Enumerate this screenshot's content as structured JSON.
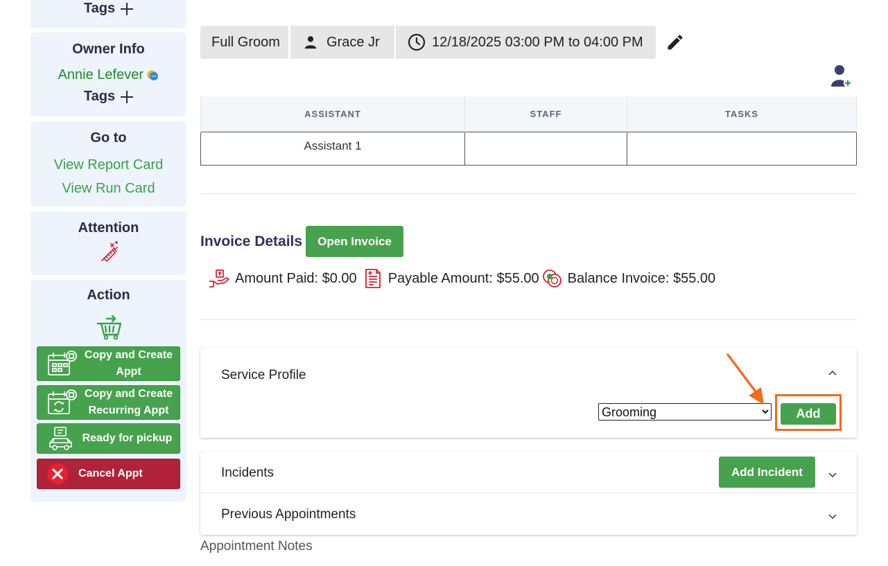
{
  "sidebar": {
    "pet_tags_label": "Tags",
    "owner_info": {
      "title": "Owner Info",
      "owner_name": "Annie Lefever",
      "tags_label": "Tags"
    },
    "go_to": {
      "title": "Go to",
      "links": [
        "View Report Card",
        "View Run Card"
      ]
    },
    "attention": {
      "title": "Attention"
    },
    "action": {
      "title": "Action",
      "buttons": {
        "copy_create_line1": "Copy and Create",
        "copy_create_line2": "Appt",
        "copy_recurring_line1": "Copy and Create",
        "copy_recurring_line2": "Recurring Appt",
        "ready_pickup": "Ready for pickup",
        "cancel": "Cancel Appt"
      }
    }
  },
  "appointment": {
    "service": "Full Groom",
    "staff": "Grace Jr",
    "time": "12/18/2025 03:00 PM to 04:00 PM"
  },
  "table": {
    "headers": [
      "ASSISTANT",
      "STAFF",
      "TASKS"
    ],
    "rows": [
      [
        "Assistant 1",
        "",
        ""
      ]
    ]
  },
  "invoice": {
    "title": "Invoice Details",
    "open_button": "Open Invoice",
    "amount_paid": "Amount Paid: $0.00",
    "payable_amount": "Payable Amount: $55.00",
    "balance": "Balance Invoice: $55.00"
  },
  "service_profile": {
    "title": "Service Profile",
    "select_value": "Grooming",
    "add_button": "Add"
  },
  "incidents": {
    "title": "Incidents",
    "add_button": "Add Incident"
  },
  "previous_appointments": {
    "title": "Previous Appointments"
  },
  "notes_label": "Appointment Notes",
  "colors": {
    "accent_green": "#46a24d",
    "danger": "#b0223a",
    "highlight": "#f26a1b",
    "card_bg": "#edf4fb"
  }
}
